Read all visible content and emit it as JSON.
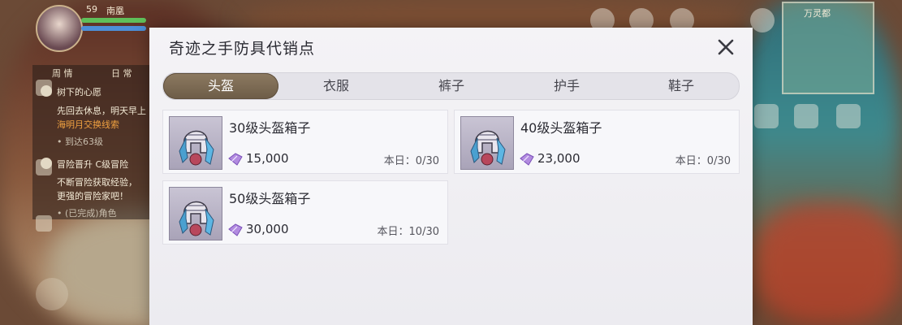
{
  "hud": {
    "level": "59",
    "player_name": "南凰",
    "quest_tabs": [
      "周 情",
      "日 常"
    ],
    "quests": [
      {
        "text": "树下的心愿",
        "style": "normal"
      },
      {
        "text": "先回去休息，明天早上",
        "style": "normal"
      },
      {
        "text": "海明月交换线索",
        "style": "orange"
      },
      {
        "text": "• 到达63级",
        "style": "dim"
      },
      {
        "text": "冒险晋升 C级冒险",
        "style": "normal"
      },
      {
        "text": "不断冒险获取经验，",
        "style": "normal"
      },
      {
        "text": "更强的冒险家吧！",
        "style": "normal"
      },
      {
        "text": "• (已完成)角色",
        "style": "dim"
      }
    ],
    "map_name": "万灵都"
  },
  "shop": {
    "title": "奇迹之手防具代销点",
    "tabs": [
      "头盔",
      "衣服",
      "裤子",
      "护手",
      "鞋子"
    ],
    "active_tab": 0,
    "items": [
      {
        "name": "30级头盔箱子",
        "price": "15,000",
        "limit": "本日：0/30"
      },
      {
        "name": "40级头盔箱子",
        "price": "23,000",
        "limit": "本日：0/30"
      },
      {
        "name": "50级头盔箱子",
        "price": "30,000",
        "limit": "本日：10/30"
      }
    ]
  },
  "icons": {
    "close": "close-icon",
    "currency": "purple-gem-icon",
    "item": "helmet-box-icon"
  },
  "colors": {
    "active_tab": "#7d6b54",
    "modal_bg": "#f2f1f5"
  }
}
